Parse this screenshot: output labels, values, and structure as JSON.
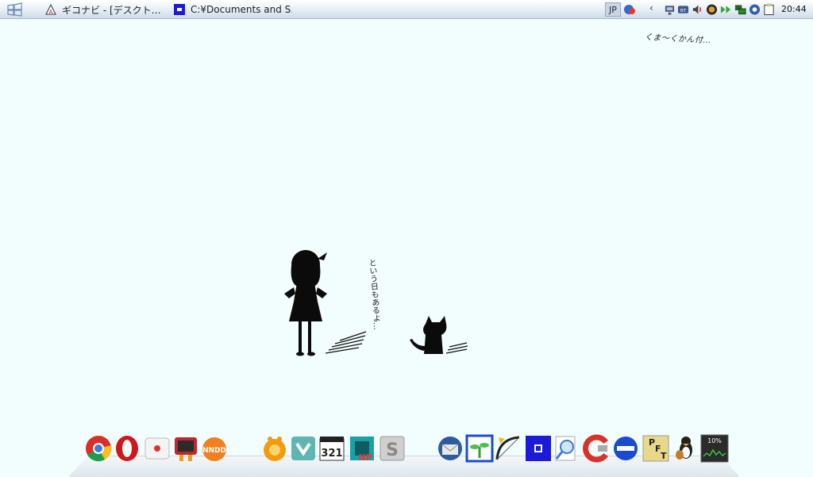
{
  "taskbar": {
    "start_icon": "windows-flag-icon",
    "tasks": [
      {
        "label": "ギコナビ - [デスクト…",
        "icon": "gikonavi-icon"
      },
      {
        "label": "C:¥Documents and S…",
        "icon": "folder-window-icon"
      }
    ],
    "ime_label": "JP",
    "tray_icons": [
      "ime-language-icon",
      "network-icon",
      "bluetooth-icon",
      "volume-icon",
      "media-icon",
      "forward-icon",
      "display-icon",
      "security-icon",
      "clipboard-icon"
    ],
    "clock": "20:44"
  },
  "desktop": {
    "corner_text": "くま〜くかん付…",
    "vertical_text": "という日もあるよ…"
  },
  "dock": {
    "items": [
      "chrome-icon",
      "opera-icon",
      "sticky-note-icon",
      "tv-robot-icon",
      "nndd-icon",
      "app-orange-icon",
      "tiles-icon",
      "calendar-321-icon",
      "notepad-np-icon",
      "s-app-icon",
      "thunderbird-icon",
      "sprout-icon",
      "bow-icon",
      "blue-square-icon",
      "magnifier-icon",
      "ccleaner-icon",
      "no-entry-icon",
      "pft-icon",
      "tux-guitar-icon",
      "cpu-monitor-icon"
    ],
    "cpu_label": "10%"
  }
}
